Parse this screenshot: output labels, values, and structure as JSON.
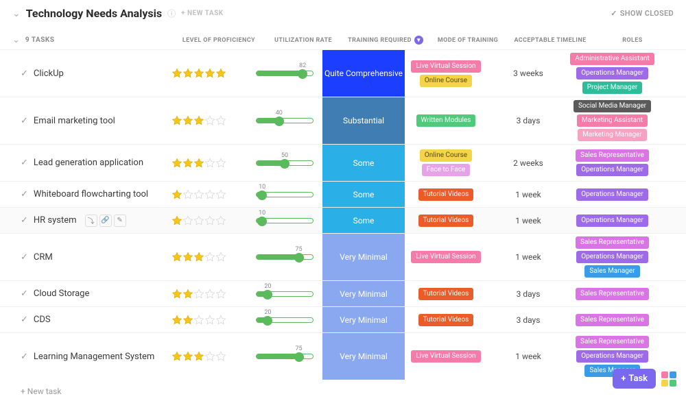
{
  "header": {
    "title": "Technology Needs Analysis",
    "newTask": "+ NEW TASK",
    "showClosed": "SHOW CLOSED"
  },
  "columns": {
    "count": "9 TASKS",
    "level": "LEVEL OF PROFICIENCY",
    "util": "UTILIZATION RATE",
    "train": "TRAINING REQUIRED",
    "mode": "MODE OF TRAINING",
    "time": "ACCEPTABLE TIMELINE",
    "roles": "ROLES"
  },
  "trainingColors": {
    "Quite Comprehensive": "#1c3fff",
    "Substantial": "#3f7db3",
    "Some": "#2ab0e6",
    "Very Minimal": "#8aa8f0"
  },
  "tagColors": {
    "Live Virtual Session": "#f77ba8",
    "Online Course": "#f5d547",
    "Written Modules": "#4fc97a",
    "Face to Face": "#e7a3e7",
    "Tutorial Videos": "#ec5b2a",
    "Administrative Assistant": "#f77ba8",
    "Operations Manager": "#9d6be8",
    "Project Manager": "#2dbd9b",
    "Social Media Manager": "#5a5a5a",
    "Marketing Assistant": "#f77ba8",
    "Marketing Manager": "#f5a3c0",
    "Sales Representative": "#d974e5",
    "Sales Manager": "#3a9be8"
  },
  "tagTextDark": [
    "Online Course"
  ],
  "tasks": [
    {
      "name": "ClickUp",
      "stars": 5,
      "util": 82,
      "training": "Quite Comprehensive",
      "mode": [
        "Live Virtual Session",
        "Online Course"
      ],
      "time": "3 weeks",
      "roles": [
        "Administrative Assistant",
        "Operations Manager",
        "Project Manager"
      ]
    },
    {
      "name": "Email marketing tool",
      "stars": 3,
      "util": 40,
      "training": "Substantial",
      "mode": [
        "Written Modules"
      ],
      "time": "3 days",
      "roles": [
        "Social Media Manager",
        "Marketing Assistant",
        "Marketing Manager"
      ]
    },
    {
      "name": "Lead generation application",
      "stars": 3,
      "util": 50,
      "training": "Some",
      "mode": [
        "Online Course",
        "Face to Face"
      ],
      "time": "2 weeks",
      "roles": [
        "Sales Representative",
        "Operations Manager"
      ]
    },
    {
      "name": "Whiteboard flowcharting tool",
      "stars": 1,
      "util": 10,
      "training": "Some",
      "mode": [
        "Tutorial Videos"
      ],
      "time": "1 week",
      "roles": [
        "Operations Manager"
      ]
    },
    {
      "name": "HR system",
      "stars": 1,
      "util": 10,
      "training": "Some",
      "mode": [
        "Tutorial Videos"
      ],
      "time": "1 week",
      "roles": [
        "Operations Manager"
      ],
      "highlight": true,
      "showIcons": true
    },
    {
      "name": "CRM",
      "stars": 3,
      "util": 75,
      "training": "Very Minimal",
      "mode": [
        "Live Virtual Session"
      ],
      "time": "1 week",
      "roles": [
        "Sales Representative",
        "Operations Manager",
        "Sales Manager"
      ]
    },
    {
      "name": "Cloud Storage",
      "stars": 2,
      "util": 20,
      "training": "Very Minimal",
      "mode": [
        "Tutorial Videos"
      ],
      "time": "3 days",
      "roles": [
        "Sales Representative"
      ]
    },
    {
      "name": "CDS",
      "stars": 2,
      "util": 20,
      "training": "Very Minimal",
      "mode": [
        "Tutorial Videos"
      ],
      "time": "3 days",
      "roles": [
        "Sales Representative"
      ]
    },
    {
      "name": "Learning Management System",
      "stars": 3,
      "util": 75,
      "training": "Very Minimal",
      "mode": [
        "Live Virtual Session"
      ],
      "time": "1 week",
      "roles": [
        "Sales Representative",
        "Operations Manager",
        "Sales Manager"
      ]
    }
  ],
  "newTaskRow": "+ New task",
  "fab": {
    "task": "Task"
  }
}
